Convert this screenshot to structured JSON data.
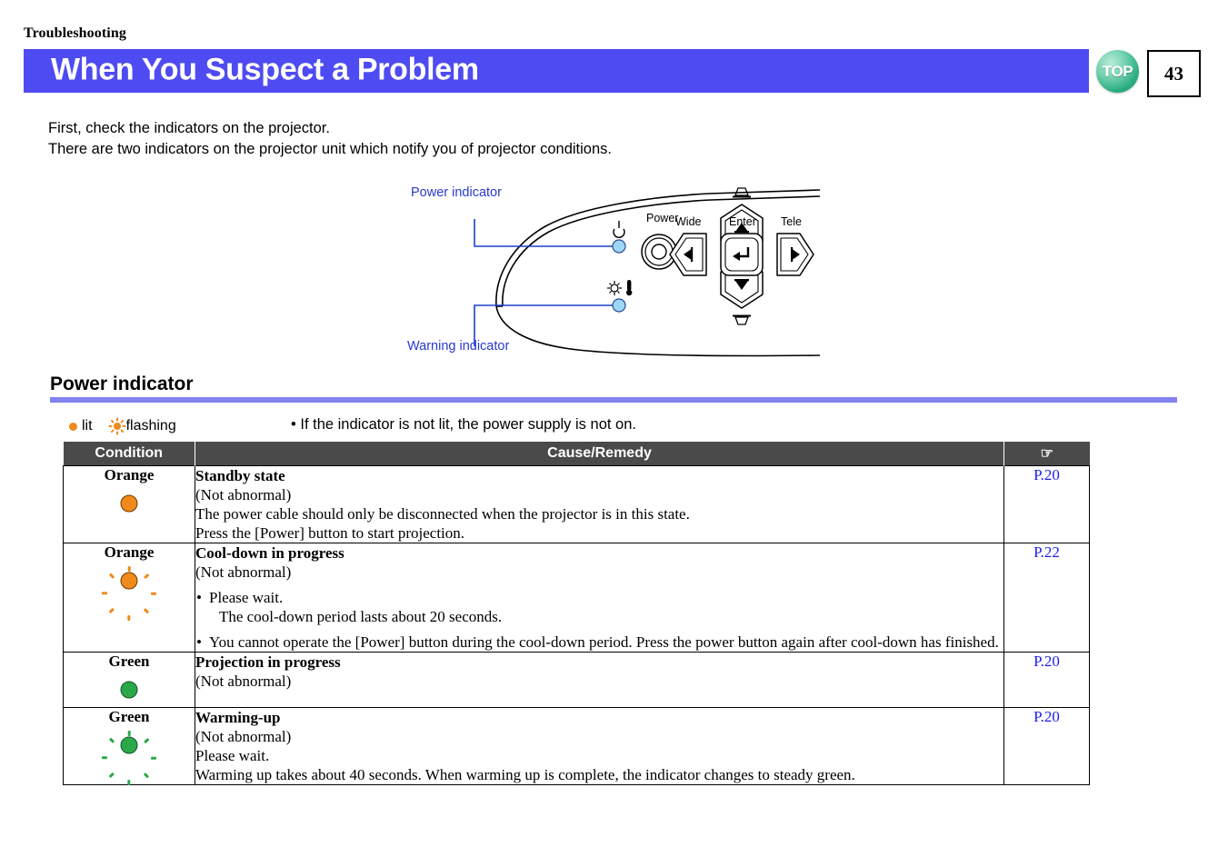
{
  "running_head": "Troubleshooting",
  "header": {
    "title": "When You Suspect a Problem",
    "banner_color": "#4f4bf2",
    "top_button_label": "TOP",
    "page_number": "43"
  },
  "intro": {
    "line1": "First, check the indicators on the projector.",
    "line2": "There are two indicators on the projector unit which notify you of projector conditions."
  },
  "figure": {
    "callout_power": "Power indicator",
    "callout_warning": "Warning indicator",
    "button_labels": {
      "power": "Power",
      "wide": "Wide",
      "enter": "Enter",
      "tele": "Tele"
    }
  },
  "section": {
    "heading": "Power indicator",
    "rule_color": "#8481f0"
  },
  "legend": {
    "lit_label": "lit",
    "flashing_label": "flashing",
    "note": "• If the indicator is not lit, the power supply is not on.",
    "lit_color": "#f08a1c",
    "flashing_color": "#f08a1c"
  },
  "table": {
    "header_bg": "#4a4a4a",
    "columns": [
      {
        "label": "Condition"
      },
      {
        "label": "Cause/Remedy"
      },
      {
        "label": "☞"
      }
    ],
    "rows": [
      {
        "condition_word": "Orange",
        "indicator_state": "lit",
        "indicator_color": "#f08a1c",
        "title": "Standby state",
        "subtitle": "(Not abnormal)",
        "lines": [
          "The power cable should only be disconnected when the projector is in this state.",
          "Press the [Power] button to start projection."
        ],
        "bullets": [],
        "reference": "P.20"
      },
      {
        "condition_word": "Orange",
        "indicator_state": "flashing",
        "indicator_color": "#f08a1c",
        "title": "Cool-down in progress",
        "subtitle": "(Not abnormal)",
        "lines": [],
        "bullets": [
          {
            "text": "Please wait.",
            "sub": "The cool-down period lasts about 20 seconds."
          },
          {
            "text": "You cannot operate the [Power] button during the cool-down period. Press the power button again after cool-down has finished.",
            "sub": ""
          }
        ],
        "reference": "P.22"
      },
      {
        "condition_word": "Green",
        "indicator_state": "lit",
        "indicator_color": "#2aa84a",
        "title": "Projection in progress",
        "subtitle": "(Not abnormal)",
        "lines": [],
        "bullets": [],
        "reference": "P.20"
      },
      {
        "condition_word": "Green",
        "indicator_state": "flashing",
        "indicator_color": "#2aa84a",
        "title": "Warming-up",
        "subtitle": "(Not abnormal)",
        "lines": [
          "Please wait.",
          "Warming up takes about 40 seconds. When warming up is complete, the indicator changes to steady green."
        ],
        "bullets": [],
        "reference": "P.20"
      }
    ]
  }
}
